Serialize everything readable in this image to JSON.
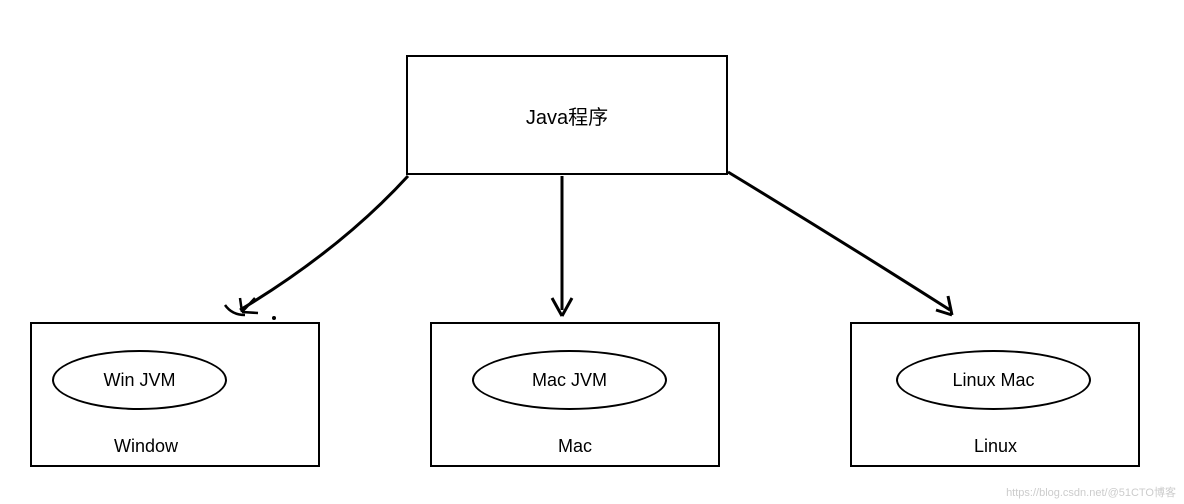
{
  "diagram": {
    "top_label": "Java程序",
    "nodes": [
      {
        "jvm": "Win JVM",
        "platform": "Window"
      },
      {
        "jvm": "Mac JVM",
        "platform": "Mac"
      },
      {
        "jvm": "Linux Mac",
        "platform": "Linux"
      }
    ]
  },
  "watermark": "https://blog.csdn.net/@51CTO博客"
}
